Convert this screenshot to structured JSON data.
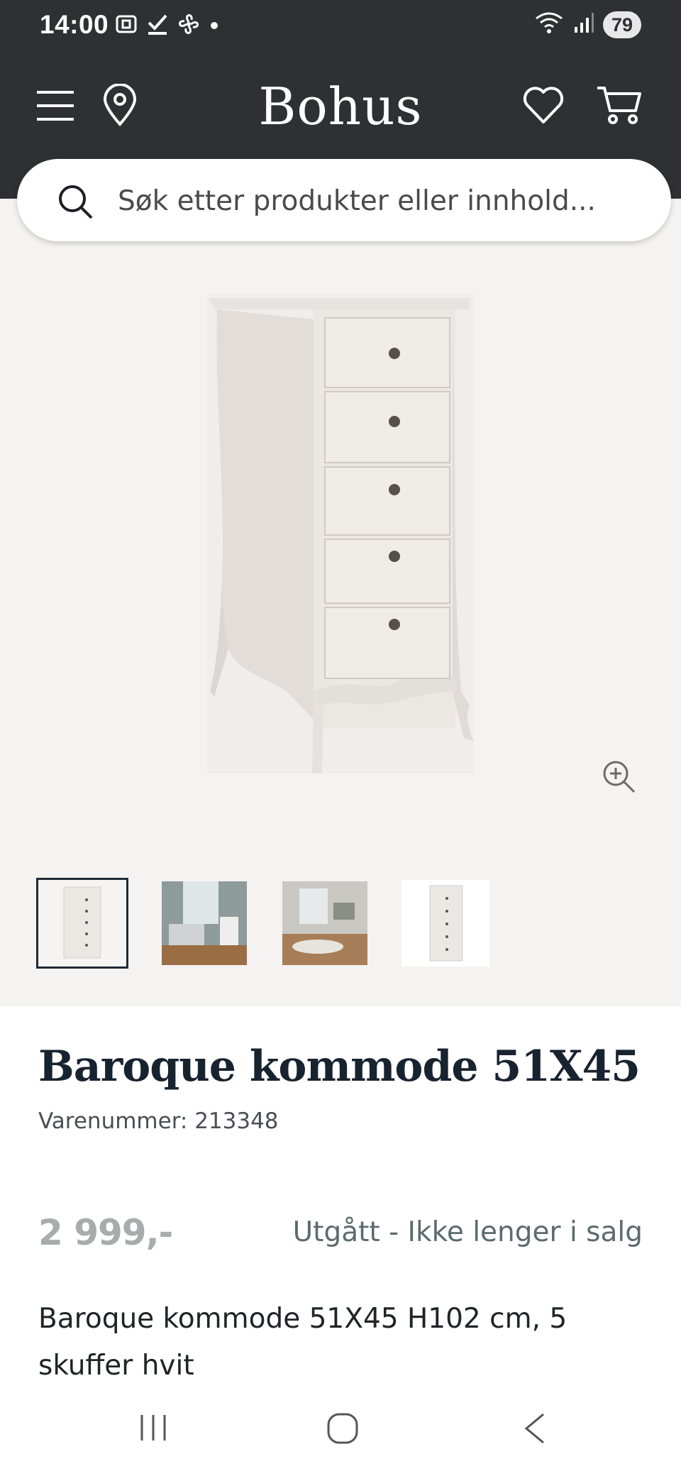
{
  "status_bar": {
    "time": "14:00",
    "left_icons": [
      "screenshot-icon",
      "download-check-icon",
      "fan-icon",
      "dot-icon"
    ],
    "right_icons": [
      "wifi-icon",
      "signal-icon"
    ],
    "battery": "79"
  },
  "header": {
    "brand": "Bohus",
    "icons": [
      "menu-icon",
      "location-pin-icon",
      "heart-icon",
      "cart-icon"
    ]
  },
  "search": {
    "placeholder": "Søk etter produkter eller innhold..."
  },
  "gallery": {
    "main_image": "white chest of drawers",
    "zoom_icon": "zoom-in-icon",
    "thumbnails": [
      {
        "alt": "white chest of drawers",
        "selected": true
      },
      {
        "alt": "room with chest and radiator",
        "selected": false
      },
      {
        "alt": "living room scene",
        "selected": false
      },
      {
        "alt": "white chest of drawers small",
        "selected": false
      }
    ]
  },
  "product": {
    "title": "Baroque kommode 51X45",
    "sku_text": "Varenummer: 213348",
    "price": "2 999,-",
    "availability": "Utgått - Ikke lenger i salg",
    "description": "Baroque kommode 51X45 H102 cm, 5 skuffer hvit"
  },
  "colors": {
    "header_bg": "#2f3034",
    "gallery_bg": "#f5f3f1",
    "price_gray": "#a9abad",
    "status_teal": "#5c6b6e",
    "title_navy": "#182330"
  },
  "system_nav": [
    "recent-apps-icon",
    "home-icon",
    "back-icon"
  ]
}
